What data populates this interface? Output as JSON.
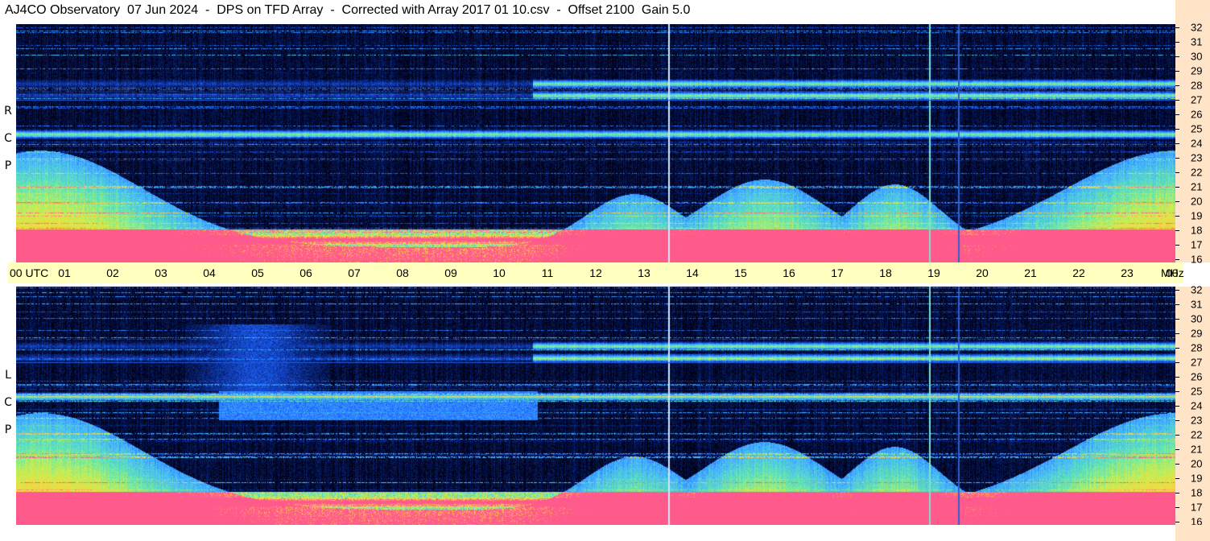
{
  "title": "AJ4CO Observatory  07 Jun 2024  -  DPS on TFD Array  -  Corrected with Array 2017 01 10.csv  -  Offset 2100  Gain 5.0",
  "chart_data": [
    {
      "type": "heatmap",
      "name": "RCP",
      "polarization_label": [
        "R",
        "C",
        "P"
      ],
      "x": [
        "00",
        "01",
        "02",
        "03",
        "04",
        "05",
        "06",
        "07",
        "08",
        "09",
        "10",
        "11",
        "12",
        "13",
        "14",
        "15",
        "16",
        "17",
        "18",
        "19",
        "20",
        "21",
        "22",
        "23",
        "00"
      ],
      "x_first_tick_suffix": "UTC",
      "xlabel": "UTC",
      "y": [
        "32",
        "31",
        "30",
        "29",
        "28",
        "27",
        "26",
        "25",
        "24",
        "23",
        "22",
        "21",
        "20",
        "19",
        "18",
        "17",
        "16"
      ],
      "ylabel": "MHz",
      "xlim": [
        0,
        24
      ],
      "ylim": [
        16,
        32
      ],
      "bright_bands_mhz": [
        27.2,
        28,
        24.6,
        17.5
      ],
      "vertical_lines_utc": [
        13.5,
        18.9,
        19.5
      ],
      "colorscale": [
        "#000014",
        "#0a2a8c",
        "#1e64ff",
        "#46b4ff",
        "#5ee6b4",
        "#c8f050",
        "#ffd23c",
        "#ff5a8c"
      ]
    },
    {
      "type": "heatmap",
      "name": "LCP",
      "polarization_label": [
        "L",
        "C",
        "P"
      ],
      "x": [
        "00",
        "01",
        "02",
        "03",
        "04",
        "05",
        "06",
        "07",
        "08",
        "09",
        "10",
        "11",
        "12",
        "13",
        "14",
        "15",
        "16",
        "17",
        "18",
        "19",
        "20",
        "21",
        "22",
        "23",
        "00"
      ],
      "xlabel": "UTC",
      "y": [
        "32",
        "31",
        "30",
        "29",
        "28",
        "27",
        "26",
        "25",
        "24",
        "23",
        "22",
        "21",
        "20",
        "19",
        "18",
        "17",
        "16"
      ],
      "ylabel": "MHz",
      "xlim": [
        0,
        24
      ],
      "ylim": [
        16,
        32
      ],
      "bright_bands_mhz": [
        27.2,
        28,
        24.6,
        17.5
      ],
      "vertical_lines_utc": [
        13.5,
        18.9,
        19.5
      ],
      "colorscale": [
        "#000014",
        "#0a2a8c",
        "#1e64ff",
        "#46b4ff",
        "#5ee6b4",
        "#c8f050",
        "#ffd23c",
        "#ff5a8c"
      ]
    }
  ],
  "time_axis": {
    "utc_label": "UTC",
    "mhz_label": "MHz"
  }
}
